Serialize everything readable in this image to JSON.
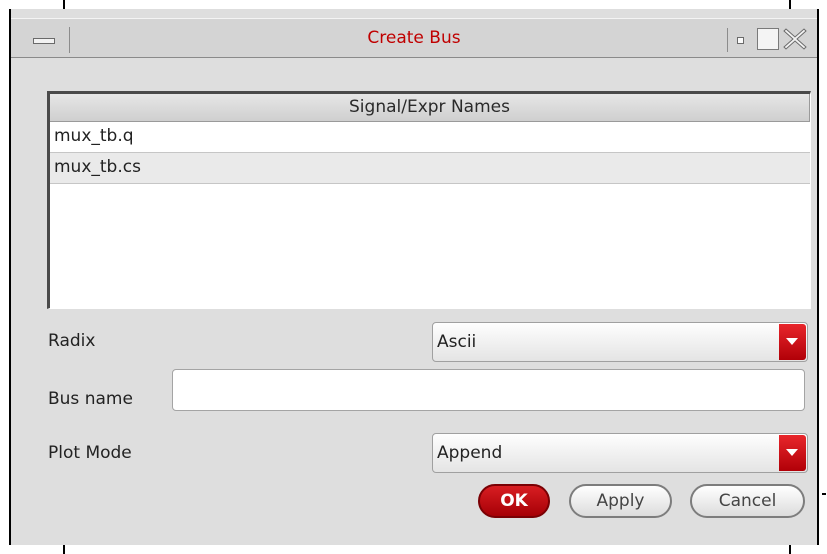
{
  "window": {
    "title": "Create Bus"
  },
  "signals": {
    "header": "Signal/Expr Names",
    "items": [
      "mux_tb.q",
      "mux_tb.cs"
    ]
  },
  "radix": {
    "label": "Radix",
    "value": "Ascii"
  },
  "bus_name": {
    "label": "Bus name",
    "value": ""
  },
  "plot_mode": {
    "label": "Plot Mode",
    "value": "Append"
  },
  "buttons": {
    "ok": "OK",
    "apply": "Apply",
    "cancel": "Cancel"
  },
  "colors": {
    "title_text": "#c00000",
    "accent_red": "#c8101a",
    "dialog_bg": "#dedede"
  }
}
